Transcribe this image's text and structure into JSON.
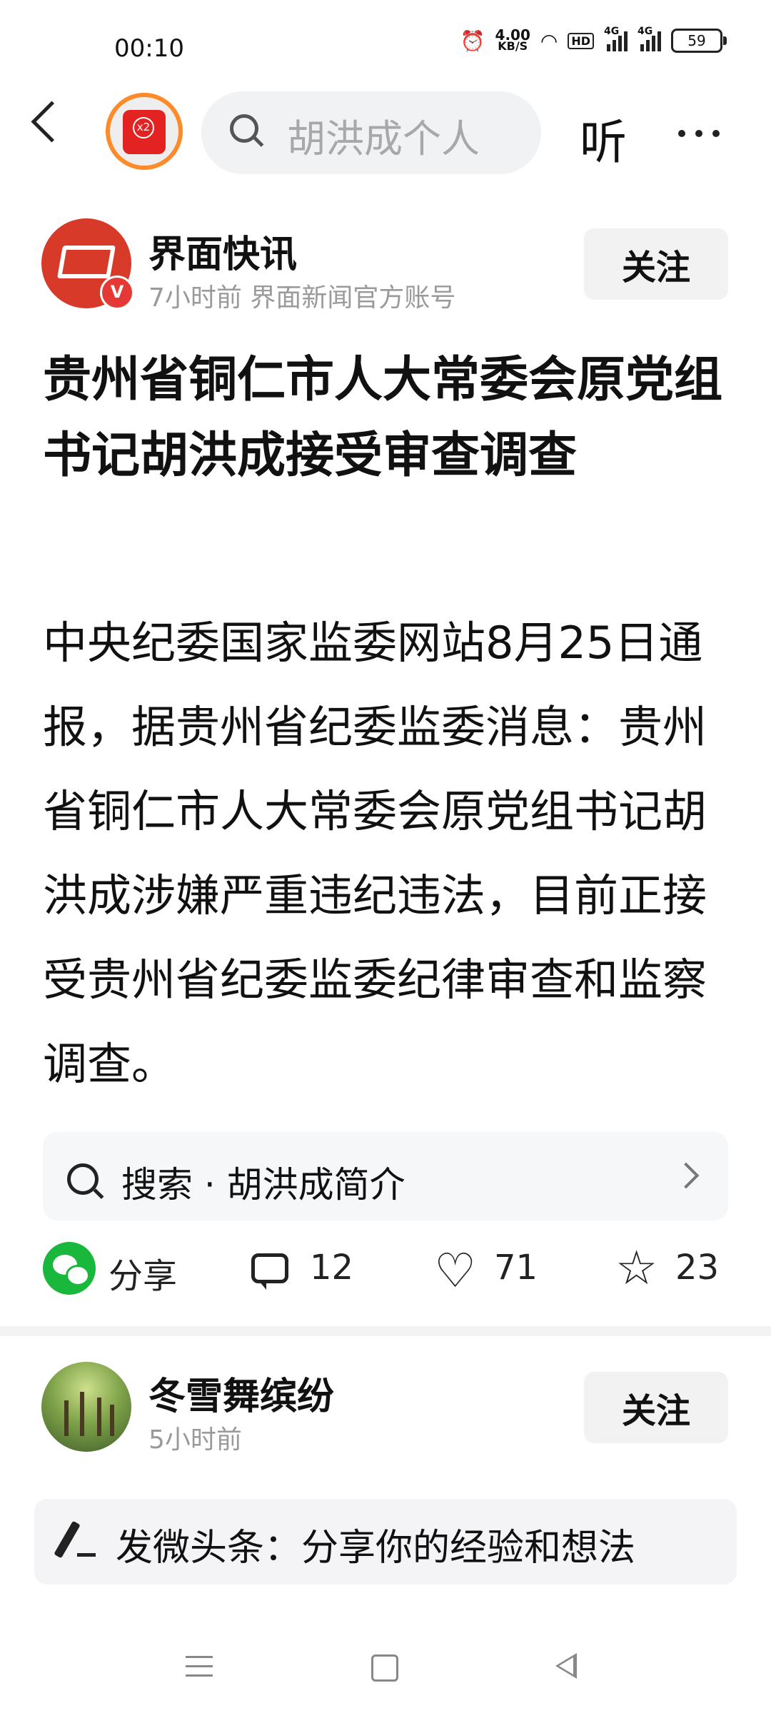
{
  "status_bar": {
    "time": "00:10",
    "net_speed_value": "4.00",
    "net_speed_unit": "KB/S",
    "hd_label": "HD",
    "sim1_label": "4G",
    "sim2_label": "4G",
    "battery": "59"
  },
  "top_nav": {
    "search_placeholder": "胡洪成个人",
    "listen_label": "听",
    "red_packet_badge": "x2"
  },
  "article": {
    "author_name": "界面快讯",
    "author_meta": "7小时前  界面新闻官方账号",
    "verified_badge": "V",
    "follow_label": "关注",
    "title": "贵州省铜仁市人大常委会原党组书记胡洪成接受审查调查",
    "body": "中央纪委国家监委网站8月25日通报，据贵州省纪委监委消息：贵州省铜仁市人大常委会原党组书记胡洪成涉嫌严重违纪违法，目前正接受贵州省纪委监委纪律审查和监察调查。"
  },
  "related_search": {
    "text": "搜索 · 胡洪成简介"
  },
  "actions": {
    "share_label": "分享",
    "comment_count": "12",
    "like_count": "71",
    "favorite_count": "23"
  },
  "comment": {
    "author_name": "冬雪舞缤纷",
    "time": "5小时前",
    "follow_label": "关注"
  },
  "composer": {
    "placeholder": "发微头条：分享你的经验和想法"
  },
  "icons": {
    "back": "back-arrow-icon",
    "search": "search-icon",
    "more": "more-icon",
    "wechat": "wechat-icon",
    "comment": "comment-icon",
    "like": "heart-icon",
    "favorite": "star-icon",
    "edit": "pen-icon"
  },
  "colors": {
    "wechat_green": "#19b83c",
    "brand_red": "#d83a2a",
    "muted_text": "#9a9a9a"
  }
}
